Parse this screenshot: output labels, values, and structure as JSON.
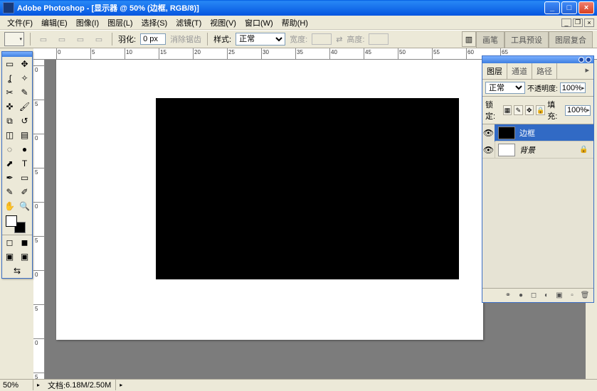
{
  "titlebar": {
    "title": "Adobe Photoshop - [显示器 @ 50% (边框, RGB/8)]"
  },
  "menu": {
    "file": "文件(F)",
    "edit": "编辑(E)",
    "image": "图像(I)",
    "layer": "图层(L)",
    "select": "选择(S)",
    "filter": "滤镜(T)",
    "view": "视图(V)",
    "window": "窗口(W)",
    "help": "帮助(H)"
  },
  "optbar": {
    "feather_label": "羽化:",
    "feather_value": "0 px",
    "antialias": "消除锯齿",
    "style_label": "样式:",
    "style_value": "正常",
    "width_label": "宽度:",
    "height_label": "高度:"
  },
  "dock": {
    "brushes": "画笔",
    "toolpresets": "工具预设",
    "layercomps": "图层复合"
  },
  "layers": {
    "tab_layers": "图层",
    "tab_channels": "通道",
    "tab_paths": "路径",
    "blend": "正常",
    "opacity_label": "不透明度:",
    "opacity_value": "100%",
    "lock_label": "锁定:",
    "fill_label": "填充:",
    "fill_value": "100%",
    "layer1": "边框",
    "layer2": "背景"
  },
  "status": {
    "zoom": "50%",
    "doc_label": "文档:",
    "doc_value": "6.18M/2.50M"
  },
  "ruler": {
    "h": [
      "0",
      "5",
      "10",
      "15",
      "20",
      "25",
      "30",
      "35",
      "40",
      "45",
      "50",
      "55",
      "60",
      "65"
    ],
    "v": [
      "0",
      "5",
      "0",
      "5",
      "0",
      "5",
      "0",
      "5",
      "0",
      "5"
    ]
  }
}
